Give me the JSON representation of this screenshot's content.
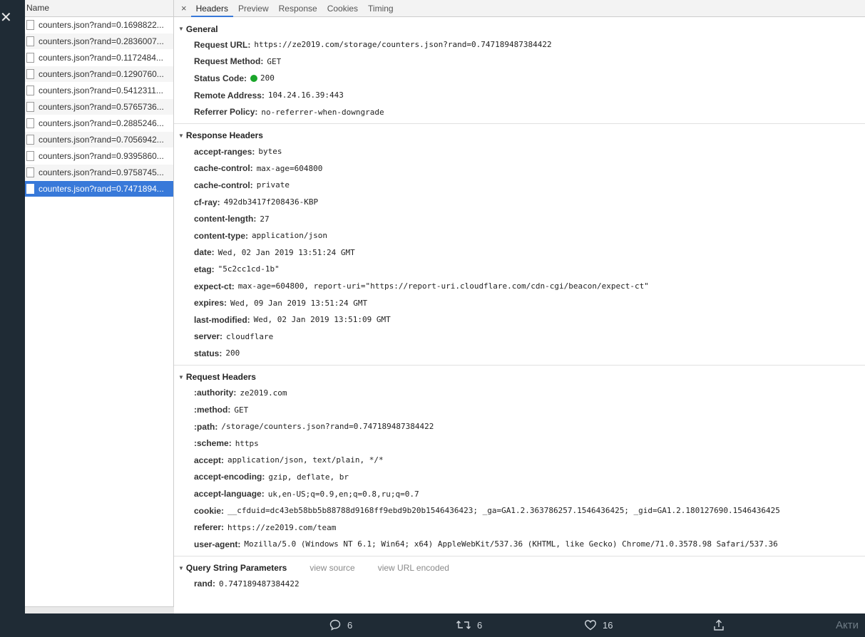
{
  "name_column": {
    "header": "Name",
    "rows": [
      "counters.json?rand=0.1698822...",
      "counters.json?rand=0.2836007...",
      "counters.json?rand=0.1172484...",
      "counters.json?rand=0.1290760...",
      "counters.json?rand=0.5412311...",
      "counters.json?rand=0.5765736...",
      "counters.json?rand=0.2885246...",
      "counters.json?rand=0.7056942...",
      "counters.json?rand=0.9395860...",
      "counters.json?rand=0.9758745...",
      "counters.json?rand=0.7471894..."
    ]
  },
  "tabs": {
    "close": "×",
    "headers": "Headers",
    "preview": "Preview",
    "response": "Response",
    "cookies": "Cookies",
    "timing": "Timing"
  },
  "general": {
    "title": "General",
    "request_url": {
      "k": "Request URL:",
      "v": "https://ze2019.com/storage/counters.json?rand=0.747189487384422"
    },
    "request_method": {
      "k": "Request Method:",
      "v": "GET"
    },
    "status_code": {
      "k": "Status Code:",
      "v": "200"
    },
    "remote_address": {
      "k": "Remote Address:",
      "v": "104.24.16.39:443"
    },
    "referrer_policy": {
      "k": "Referrer Policy:",
      "v": "no-referrer-when-downgrade"
    }
  },
  "response_headers": {
    "title": "Response Headers",
    "accept_ranges": {
      "k": "accept-ranges:",
      "v": "bytes"
    },
    "cache_control_1": {
      "k": "cache-control:",
      "v": "max-age=604800"
    },
    "cache_control_2": {
      "k": "cache-control:",
      "v": "private"
    },
    "cf_ray": {
      "k": "cf-ray:",
      "v": "492db3417f208436-KBP"
    },
    "content_length": {
      "k": "content-length:",
      "v": "27"
    },
    "content_type": {
      "k": "content-type:",
      "v": "application/json"
    },
    "date": {
      "k": "date:",
      "v": "Wed, 02 Jan 2019 13:51:24 GMT"
    },
    "etag": {
      "k": "etag:",
      "v": "\"5c2cc1cd-1b\""
    },
    "expect_ct": {
      "k": "expect-ct:",
      "v": "max-age=604800, report-uri=\"https://report-uri.cloudflare.com/cdn-cgi/beacon/expect-ct\""
    },
    "expires": {
      "k": "expires:",
      "v": "Wed, 09 Jan 2019 13:51:24 GMT"
    },
    "last_modified": {
      "k": "last-modified:",
      "v": "Wed, 02 Jan 2019 13:51:09 GMT"
    },
    "server": {
      "k": "server:",
      "v": "cloudflare"
    },
    "status": {
      "k": "status:",
      "v": "200"
    }
  },
  "request_headers": {
    "title": "Request Headers",
    "authority": {
      "k": ":authority:",
      "v": "ze2019.com"
    },
    "method": {
      "k": ":method:",
      "v": "GET"
    },
    "path": {
      "k": ":path:",
      "v": "/storage/counters.json?rand=0.747189487384422"
    },
    "scheme": {
      "k": ":scheme:",
      "v": "https"
    },
    "accept": {
      "k": "accept:",
      "v": "application/json, text/plain, */*"
    },
    "accept_encoding": {
      "k": "accept-encoding:",
      "v": "gzip, deflate, br"
    },
    "accept_language": {
      "k": "accept-language:",
      "v": "uk,en-US;q=0.9,en;q=0.8,ru;q=0.7"
    },
    "cookie": {
      "k": "cookie:",
      "v": "__cfduid=dc43eb58bb5b88788d9168ff9ebd9b20b1546436423; _ga=GA1.2.363786257.1546436425; _gid=GA1.2.180127690.1546436425"
    },
    "referer": {
      "k": "referer:",
      "v": "https://ze2019.com/team"
    },
    "user_agent": {
      "k": "user-agent:",
      "v": "Mozilla/5.0 (Windows NT 6.1; Win64; x64) AppleWebKit/537.36 (KHTML, like Gecko) Chrome/71.0.3578.98 Safari/537.36"
    }
  },
  "query_string": {
    "title": "Query String Parameters",
    "view_source": "view source",
    "view_url_encoded": "view URL encoded",
    "rand": {
      "k": "rand:",
      "v": "0.747189487384422"
    }
  },
  "tweet_actions": {
    "reply_count": "6",
    "retweet_count": "6",
    "like_count": "16",
    "overlay_text": "Акти"
  },
  "colors": {
    "selected_row": "#3879d9",
    "status_dot": "#1aa52a",
    "page_background": "#1f2b35"
  }
}
